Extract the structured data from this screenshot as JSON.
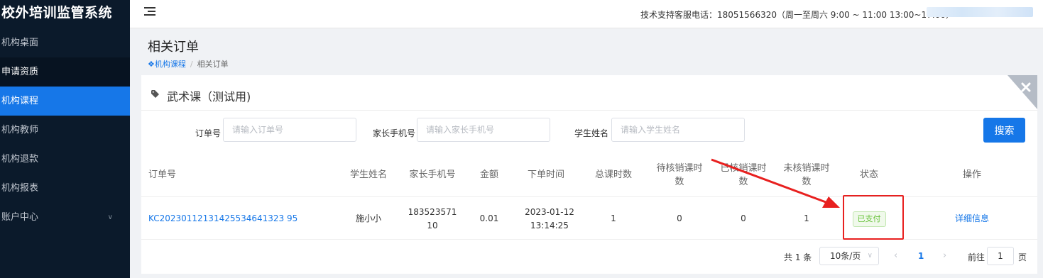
{
  "app": {
    "brand": "校外培训监管系统"
  },
  "sidebar": {
    "items": [
      {
        "label": "机构桌面"
      },
      {
        "label": "申请资质"
      },
      {
        "label": "机构课程"
      },
      {
        "label": "机构教师"
      },
      {
        "label": "机构退款"
      },
      {
        "label": "机构报表"
      },
      {
        "label": "账户中心"
      }
    ]
  },
  "header": {
    "support": "技术支持客服电话：18051566320（周一至周六 9:00 ~ 11:00 13:00~17:00）"
  },
  "page": {
    "title": "相关订单",
    "breadcrumb": {
      "home": "机构课程",
      "sep": "/",
      "current": "相关订单"
    }
  },
  "card": {
    "course_title": "武术课（测试用)"
  },
  "filters": {
    "order_no_label": "订单号",
    "order_no_placeholder": "请输入订单号",
    "parent_phone_label": "家长手机号",
    "parent_phone_placeholder": "请输入家长手机号",
    "student_name_label": "学生姓名",
    "student_name_placeholder": "请输入学生姓名",
    "search_label": "搜索"
  },
  "table": {
    "headers": {
      "order_no": "订单号",
      "student": "学生姓名",
      "phone": "家长手机号",
      "amount": "金额",
      "time": "下单时间",
      "total_hours": "总课时数",
      "pending_hours": "待核销课时数",
      "used_hours": "已核销课时数",
      "unused_hours": "未核销课时数",
      "status": "状态",
      "actions": "操作"
    },
    "rows": [
      {
        "order_no": "KC20230112131425534641323 95",
        "student": "施小小",
        "phone": "18352357110",
        "amount": "0.01",
        "time": "2023-01-12 13:14:25",
        "total_hours": "1",
        "pending_hours": "0",
        "used_hours": "0",
        "unused_hours": "1",
        "status": "已支付",
        "action": "详细信息"
      }
    ]
  },
  "pagination": {
    "total": "共 1 条",
    "page_size": "10条/页",
    "prev": "‹",
    "current": "1",
    "next": "›",
    "goto_label": "前往",
    "goto_value": "1",
    "page_unit": "页"
  },
  "colors": {
    "accent": "#1677e8",
    "sidebar_bg": "#0b1a2b",
    "success": "#67c23a",
    "annotation": "#e8201f"
  },
  "icons": [
    "menu-toggle-icon",
    "home-icon",
    "tag-icon",
    "close-icon",
    "chevron-down-icon"
  ]
}
